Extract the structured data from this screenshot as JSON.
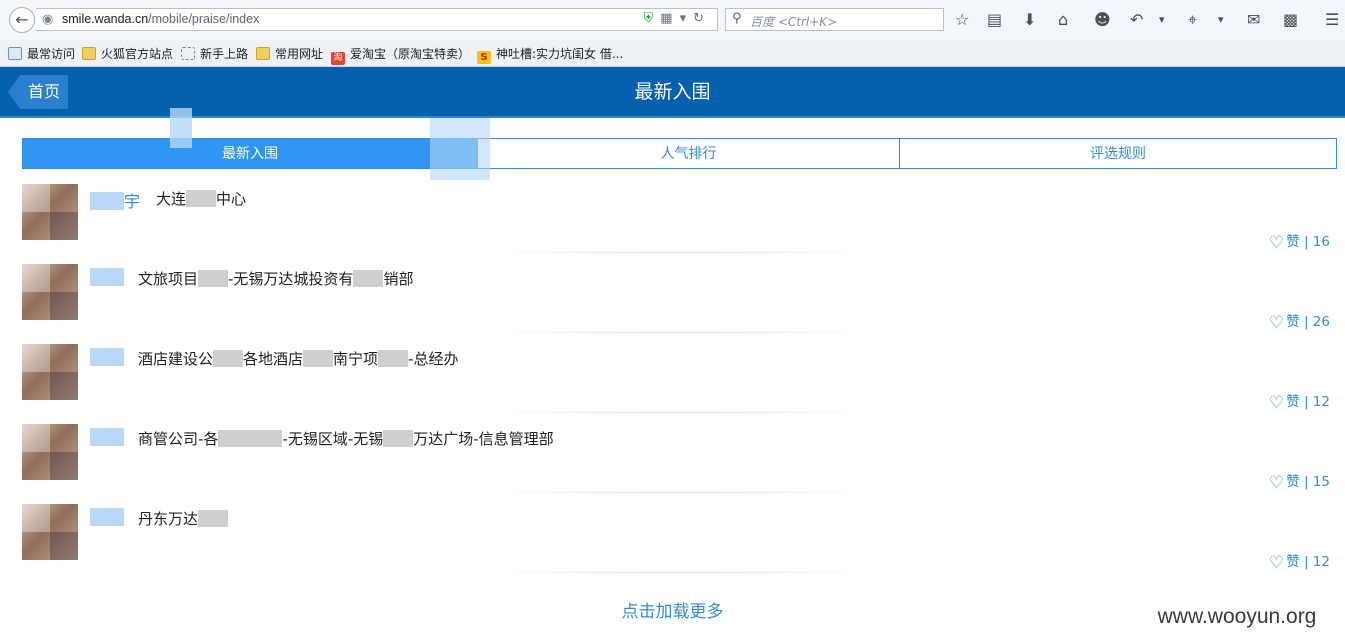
{
  "browser": {
    "url_host": "smile.wanda.cn",
    "url_path": "/mobile/praise/index",
    "search_placeholder": "百度 <Ctrl+K>",
    "bookmarks": [
      {
        "label": "最常访问",
        "icon": "firefox-page-icon"
      },
      {
        "label": "火狐官方站点",
        "icon": "folder-icon"
      },
      {
        "label": "新手上路",
        "icon": "blank-page-icon"
      },
      {
        "label": "常用网址",
        "icon": "folder-icon"
      },
      {
        "label": "爱淘宝（原淘宝特卖）",
        "icon": "taobao-icon"
      },
      {
        "label": "神吐槽:实力坑闺女 借...",
        "icon": "s-logo-icon"
      }
    ]
  },
  "app": {
    "home_label": "首页",
    "title": "最新入围",
    "tabs": [
      {
        "label": "最新入围",
        "active": true
      },
      {
        "label": "人气排行",
        "active": false
      },
      {
        "label": "评选规则",
        "active": false
      }
    ],
    "like_word": "赞",
    "load_more": "点击加载更多"
  },
  "items": [
    {
      "name_visible": "宇",
      "dept_parts": [
        "大连",
        "中心"
      ],
      "likes": "| 16"
    },
    {
      "name_visible": "",
      "dept_parts": [
        "文旅项目",
        "-无锡万达城投资有",
        "销部"
      ],
      "likes": "| 26"
    },
    {
      "name_visible": "",
      "dept_parts": [
        "酒店建设公",
        "各地酒店",
        "南宁项",
        "-总经办"
      ],
      "likes": "| 12"
    },
    {
      "name_visible": "",
      "dept_parts": [
        "商管公司-各",
        "-无锡区域-无锡",
        "万达广场-信息管理部"
      ],
      "likes": "| 15"
    },
    {
      "name_visible": "",
      "dept_parts": [
        "丹东万达"
      ],
      "likes": "| 12"
    }
  ],
  "watermark": "www.wooyun.org",
  "colors": {
    "header": "#0560b0",
    "accent": "#2f8de0",
    "tab_active": "#2f97f3"
  }
}
